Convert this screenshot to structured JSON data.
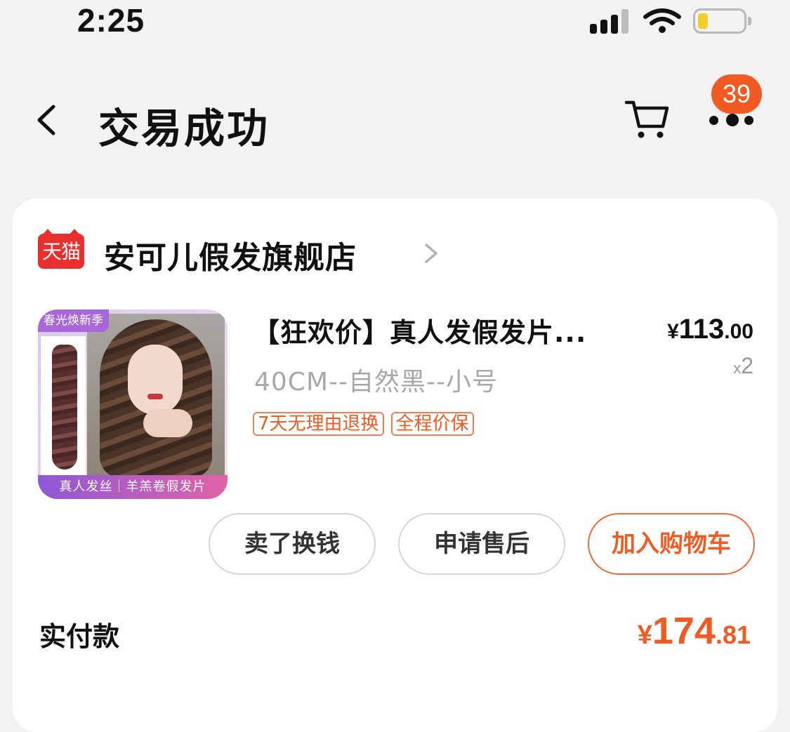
{
  "status": {
    "time": "2:25"
  },
  "nav": {
    "title": "交易成功",
    "badge": "39"
  },
  "store": {
    "logo_text": "天猫",
    "name": "安可儿假发旗舰店"
  },
  "product": {
    "title": "【狂欢价】真人发假发片...",
    "price_currency": "¥",
    "price_int": "113",
    "price_dec": ".00",
    "qty_prefix": "x",
    "qty": "2",
    "spec": "40CM--自然黑--小号",
    "tags": [
      "7天无理由退换",
      "全程价保"
    ],
    "thumb_tag": "春光焕新季",
    "thumb_caption": "真人发丝｜羊羔卷假发片"
  },
  "actions": {
    "sell": "卖了换钱",
    "after_sale": "申请售后",
    "add_cart": "加入购物车"
  },
  "paid": {
    "label": "实付款",
    "currency": "¥",
    "int": "174",
    "dec": ".81"
  },
  "colors": {
    "accent": "#f15a22",
    "tmall_red": "#ea2d2d"
  },
  "icons": [
    "back-icon",
    "cart-icon",
    "more-icon",
    "chevron-right-icon",
    "signal-icon",
    "wifi-icon",
    "battery-icon"
  ]
}
